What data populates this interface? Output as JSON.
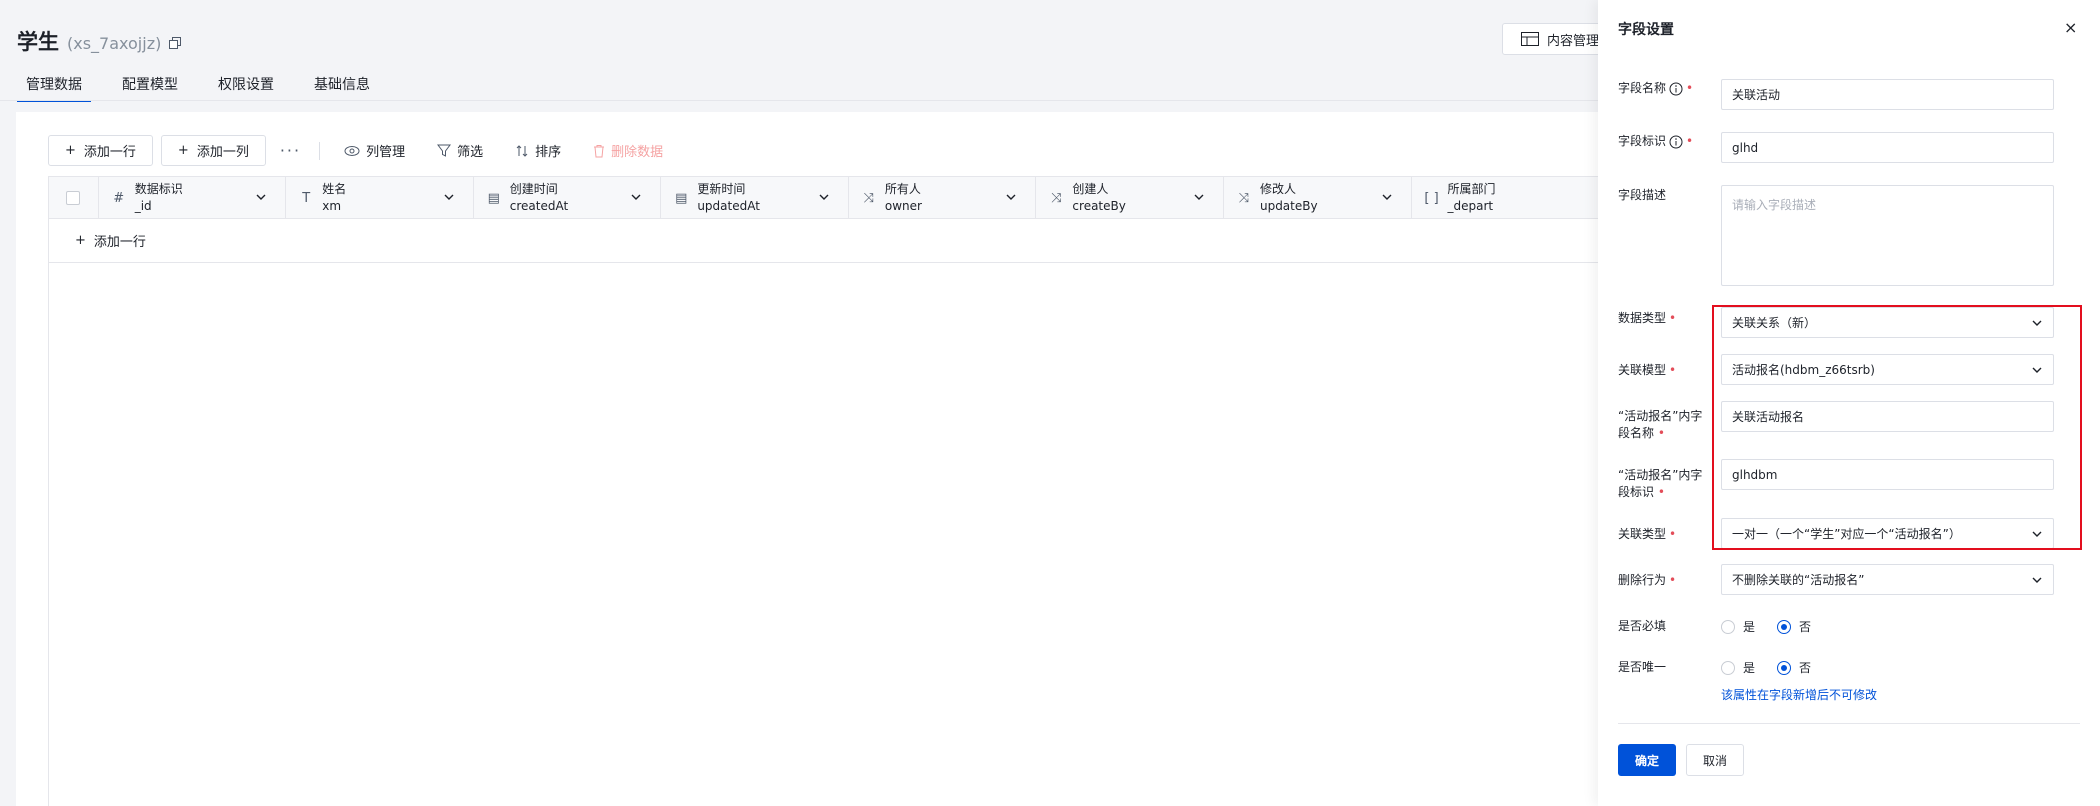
{
  "header": {
    "title": "学生",
    "code": "(xs_7axojjz)",
    "content_button": "内容管理"
  },
  "tabs": [
    {
      "label": "管理数据",
      "active": true
    },
    {
      "label": "配置模型",
      "active": false
    },
    {
      "label": "权限设置",
      "active": false
    },
    {
      "label": "基础信息",
      "active": false
    }
  ],
  "toolbar": {
    "add_row": "添加一行",
    "add_column": "添加一列",
    "more": "···",
    "column_manage": "列管理",
    "filter": "筛选",
    "sort": "排序",
    "delete_data": "删除数据"
  },
  "grid": {
    "columns": [
      {
        "icon": "#",
        "label": "数据标识",
        "key": "_id"
      },
      {
        "icon": "T",
        "label": "姓名",
        "key": "xm"
      },
      {
        "icon": "▤",
        "label": "创建时间",
        "key": "createdAt"
      },
      {
        "icon": "▤",
        "label": "更新时间",
        "key": "updatedAt"
      },
      {
        "icon": "⤨",
        "label": "所有人",
        "key": "owner"
      },
      {
        "icon": "⤨",
        "label": "创建人",
        "key": "createBy"
      },
      {
        "icon": "⤨",
        "label": "修改人",
        "key": "updateBy"
      },
      {
        "icon": "[ ]",
        "label": "所属部门",
        "key": "_depart"
      }
    ],
    "add_row": "添加一行"
  },
  "drawer": {
    "title": "字段设置",
    "close": "×",
    "field_name": {
      "label": "字段名称",
      "value": "关联活动"
    },
    "field_key": {
      "label": "字段标识",
      "value": "glhd"
    },
    "field_desc": {
      "label": "字段描述",
      "placeholder": "请输入字段描述"
    },
    "data_type": {
      "label": "数据类型",
      "value": "关联关系（新）"
    },
    "relation_model": {
      "label": "关联模型",
      "value": "活动报名(hdbm_z66tsrb)"
    },
    "inner_name": {
      "label_line1": "“活动报名”内字",
      "label_line2": "段名称",
      "value": "关联活动报名"
    },
    "inner_key": {
      "label_line1": "“活动报名”内字",
      "label_line2": "段标识",
      "value": "glhdbm"
    },
    "relation_type": {
      "label": "关联类型",
      "value": "一对一（一个“学生”对应一个“活动报名”）"
    },
    "delete_behavior": {
      "label": "删除行为",
      "value": "不删除关联的“活动报名”"
    },
    "required": {
      "label": "是否必填",
      "yes": "是",
      "no": "否",
      "selected": "否"
    },
    "unique": {
      "label": "是否唯一",
      "yes": "是",
      "no": "否",
      "selected": "否"
    },
    "unique_hint": "该属性在字段新增后不可修改",
    "confirm": "确定",
    "cancel": "取消"
  },
  "colors": {
    "primary": "#0052d9",
    "required": "#e34d59",
    "highlight": "#e30e1e"
  }
}
